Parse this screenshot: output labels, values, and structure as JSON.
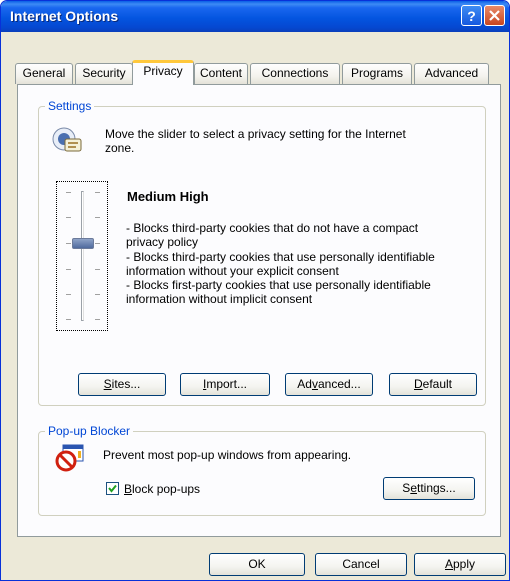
{
  "window": {
    "title": "Internet Options",
    "help_glyph": "?",
    "close_icon": "close-icon"
  },
  "tabs": [
    {
      "label": "General"
    },
    {
      "label": "Security"
    },
    {
      "label": "Privacy",
      "active": true
    },
    {
      "label": "Content"
    },
    {
      "label": "Connections"
    },
    {
      "label": "Programs"
    },
    {
      "label": "Advanced"
    }
  ],
  "settings": {
    "group_label": "Settings",
    "icon": "privacy-globe-icon",
    "intro_line1": "Move the slider to select a privacy setting for the Internet",
    "intro_line2": "zone.",
    "level_name": "Medium High",
    "description_lines": [
      "- Blocks third-party cookies that do not have a compact",
      "privacy policy",
      "- Blocks third-party cookies that use personally identifiable",
      "information without your explicit consent",
      "- Blocks first-party cookies that use personally identifiable",
      "information without implicit consent"
    ],
    "slider_level": "Medium High",
    "buttons": {
      "sites": {
        "label": "Sites...",
        "key": "S",
        "rest": "ites..."
      },
      "import": {
        "label": "Import...",
        "key": "I",
        "rest": "mport..."
      },
      "advanced": {
        "pre": "Ad",
        "key": "v",
        "rest": "anced..."
      },
      "default": {
        "key": "D",
        "rest": "efault"
      }
    }
  },
  "popup": {
    "group_label": "Pop-up Blocker",
    "icon": "popup-blocker-icon",
    "description": "Prevent most pop-up windows from appearing.",
    "checkbox": {
      "checked": true,
      "key": "B",
      "rest": "lock pop-ups"
    },
    "settings_button": {
      "pre": "S",
      "key": "e",
      "rest": "ttings..."
    }
  },
  "footer": {
    "ok_label": "OK",
    "cancel_label": "Cancel",
    "apply": {
      "key": "A",
      "rest": "pply"
    }
  },
  "colors": {
    "titlebar": "#0455e0",
    "group_label": "#0046d5",
    "active_tab_highlight": "#ffc83c"
  }
}
